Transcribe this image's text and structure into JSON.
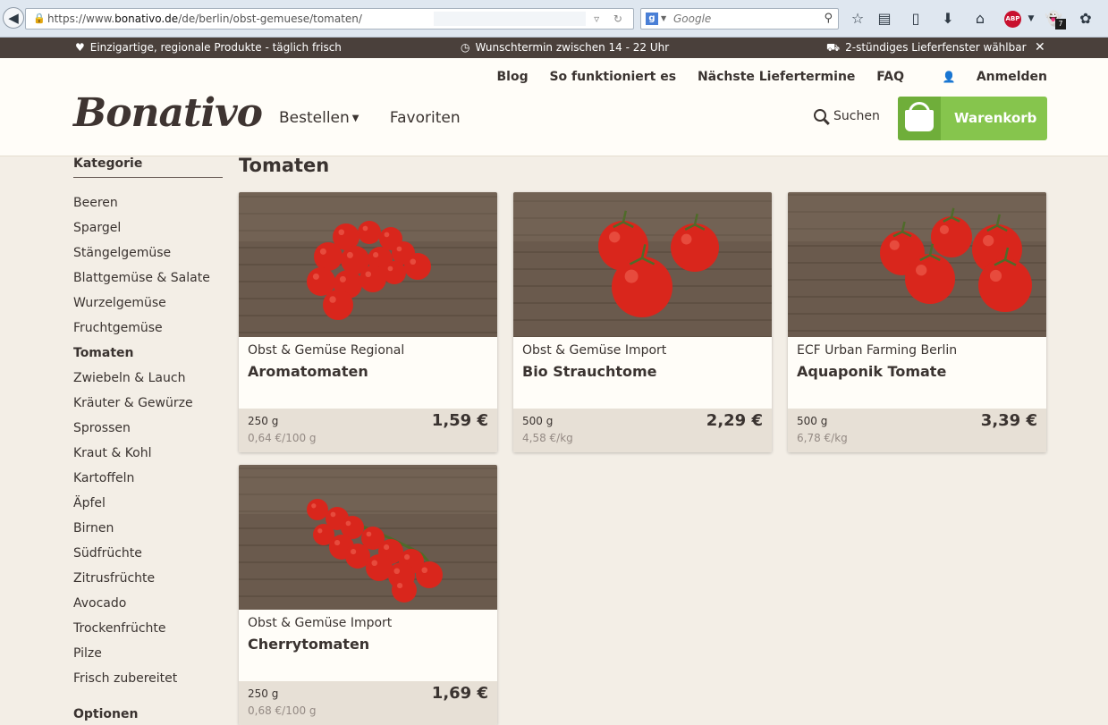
{
  "browser": {
    "url_prefix": "https://www.",
    "url_domain": "bonativo.de",
    "url_path": "/de/berlin/obst-gemuese/tomaten/",
    "search_engine": "g",
    "search_placeholder": "Google",
    "back_glyph": "◀",
    "toolbar_icons": [
      "bookmark-star-icon",
      "reading-list-icon",
      "sidebar-icon",
      "download-icon",
      "home-icon",
      "adblock-plus-icon",
      "ghostery-icon",
      "extension-icon"
    ],
    "abp_label": "ABP",
    "ghostery_count": "7"
  },
  "info_bar": {
    "items": [
      {
        "icon": "heart-icon",
        "glyph": "♥",
        "text": "Einzigartige, regionale Produkte - täglich frisch"
      },
      {
        "icon": "clock-icon",
        "glyph": "◷",
        "text": "Wunschtermin zwischen 14 - 22 Uhr"
      },
      {
        "icon": "truck-icon",
        "glyph": "⛟",
        "text": "2-stündiges Lieferfenster wählbar"
      }
    ],
    "close_glyph": "✕"
  },
  "header": {
    "logo": "Bonativo",
    "top_links": [
      "Blog",
      "So funktioniert es",
      "Nächste Liefertermine",
      "FAQ"
    ],
    "login_label": "Anmelden",
    "nav": {
      "order": "Bestellen",
      "favorites": "Favoriten"
    },
    "search_label": "Suchen",
    "cart_label": "Warenkorb"
  },
  "sidebar": {
    "title": "Kategorie",
    "categories": [
      "Beeren",
      "Spargel",
      "Stängelgemüse",
      "Blattgemüse & Salate",
      "Wurzelgemüse",
      "Fruchtgemüse",
      "Tomaten",
      "Zwiebeln & Lauch",
      "Kräuter & Gewürze",
      "Sprossen",
      "Kraut & Kohl",
      "Kartoffeln",
      "Äpfel",
      "Birnen",
      "Südfrüchte",
      "Zitrusfrüchte",
      "Avocado",
      "Trockenfrüchte",
      "Pilze",
      "Frisch zubereitet"
    ],
    "active_category": "Tomaten",
    "options_title": "Optionen"
  },
  "main": {
    "title": "Tomaten",
    "products": [
      {
        "supplier": "Obst & Gemüse Regional",
        "name": "Aromatomaten",
        "weight": "250 g",
        "unit_price": "0,64 €/100 g",
        "price": "1,59 €",
        "image": "cluster-cocktail-tomatoes"
      },
      {
        "supplier": "Obst & Gemüse Import",
        "name": "Bio Strauchtome",
        "weight": "500 g",
        "unit_price": "4,58 €/kg",
        "price": "2,29 €",
        "image": "three-vine-tomatoes"
      },
      {
        "supplier": "ECF Urban Farming Berlin",
        "name": "Aquaponik Tomate",
        "weight": "500 g",
        "unit_price": "6,78 €/kg",
        "price": "3,39 €",
        "image": "scattered-tomatoes"
      },
      {
        "supplier": "Obst & Gemüse Import",
        "name": "Cherrytomaten",
        "weight": "250 g",
        "unit_price": "0,68 €/100 g",
        "price": "1,69 €",
        "image": "cherry-tomato-vine"
      }
    ]
  },
  "colors": {
    "info_bar": "#4a403b",
    "cart_green": "#86c54d",
    "cart_green_dark": "#6fae3a",
    "page_bg": "#f3eee6",
    "tomato_red": "#d9261c"
  }
}
